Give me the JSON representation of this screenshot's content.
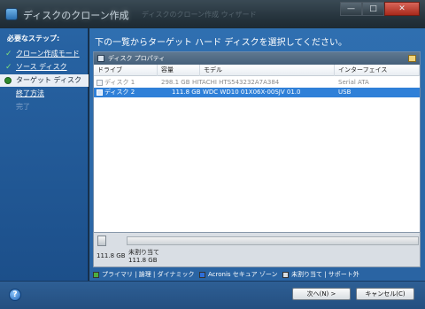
{
  "window": {
    "title": "ディスクのクローン作成",
    "ghost_text": "ディスクのクローン作成 ウィザード",
    "controls": {
      "minimize": "—",
      "maximize": "□",
      "close": "✕"
    }
  },
  "sidebar": {
    "heading": "必要なステップ:",
    "steps": [
      {
        "label": "クローン作成モード",
        "state": "done",
        "mark": "✓"
      },
      {
        "label": "ソース ディスク",
        "state": "done",
        "mark": "✓"
      },
      {
        "label": "ターゲット ディスク",
        "state": "current"
      },
      {
        "label": "終了方法",
        "state": "pending"
      },
      {
        "label": "完了",
        "state": "disabled"
      }
    ]
  },
  "main": {
    "instruction": "下の一覧からターゲット ハード ディスクを選択してください。",
    "props_bar": "ディスク プロパティ",
    "columns": [
      "ドライブ",
      "容量",
      "モデル",
      "インターフェイス"
    ],
    "rows": [
      {
        "drive": "ディスク 1",
        "capacity": "298.1 GB",
        "model": "HITACHI HTS543232A7A384",
        "interface": "Serial ATA",
        "selected": false,
        "dim": true
      },
      {
        "drive": "ディスク 2",
        "capacity": "111.8 GB",
        "model": "WDC WD10 01X06X-00SJV 01.0",
        "interface": "USB",
        "selected": true,
        "dim": false
      }
    ]
  },
  "diskmap": {
    "disk_size": "111.8 GB",
    "partition_label": "未割り当て",
    "partition_size": "111.8 GB"
  },
  "legend": {
    "items": [
      {
        "label": "プライマリ | 論理 | ダイナミック",
        "color": "#4cae3f"
      },
      {
        "label": "Acronis セキュア ゾーン",
        "color": "#2f6fd8"
      },
      {
        "label": "未割り当て | サポート外",
        "color": "#d9dde1"
      }
    ]
  },
  "footer": {
    "help": "?",
    "next_button": "次へ(N) >",
    "cancel_button": "キャンセル(C)"
  }
}
